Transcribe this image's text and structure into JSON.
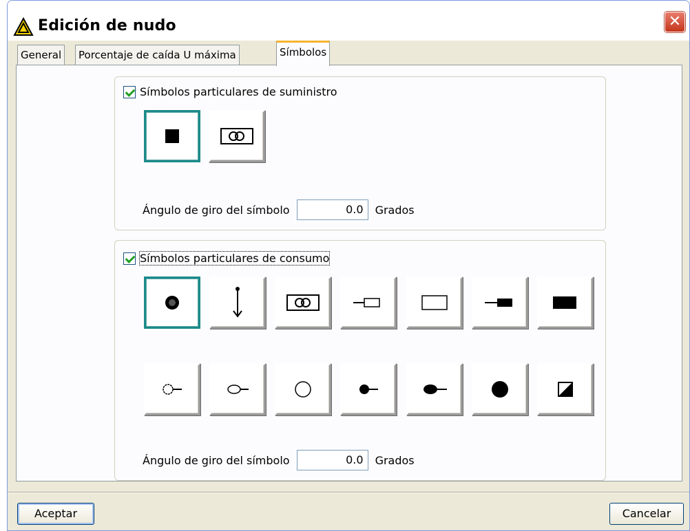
{
  "window": {
    "title": "Edición de nudo",
    "title_icon": "warning-triangle-icon",
    "close_icon": "close-icon",
    "close_glyph": "✕"
  },
  "tabs": [
    {
      "label": "General",
      "active": false
    },
    {
      "label": "Porcentaje de caída U máxima",
      "active": false
    },
    {
      "label": "Símbolos",
      "active": true
    }
  ],
  "supply": {
    "checkbox_label": "Símbolos particulares de suministro",
    "checked": true,
    "symbols": [
      "filled-square-icon",
      "double-circle-box-icon"
    ],
    "selected_index": 0,
    "angle_label": "Ángulo de giro del símbolo",
    "angle_value": "0.0",
    "angle_unit": "Grados"
  },
  "consumption": {
    "checkbox_label": "Símbolos particulares de consumo",
    "checked": true,
    "symbols_row1": [
      "dark-circle-icon",
      "arrow-down-icon",
      "double-circle-box-icon",
      "line-small-rect-icon",
      "empty-rect-icon",
      "line-filled-rect-icon",
      "filled-rect-icon"
    ],
    "symbols_row2": [
      "open-small-circle-line-icon",
      "open-ellipse-line-icon",
      "open-circle-icon",
      "filled-small-circle-line-icon",
      "filled-ellipse-line-icon",
      "filled-circle-icon",
      "half-filled-square-icon"
    ],
    "selected_index": 0,
    "angle_label": "Ángulo de giro del símbolo",
    "angle_value": "0.0",
    "angle_unit": "Grados"
  },
  "buttons": {
    "ok": "Aceptar",
    "cancel": "Cancelar"
  },
  "colors": {
    "selected_border": "#1d8a8a",
    "active_tab_accent": "#f8b32e",
    "close_red": "#c4351b"
  }
}
